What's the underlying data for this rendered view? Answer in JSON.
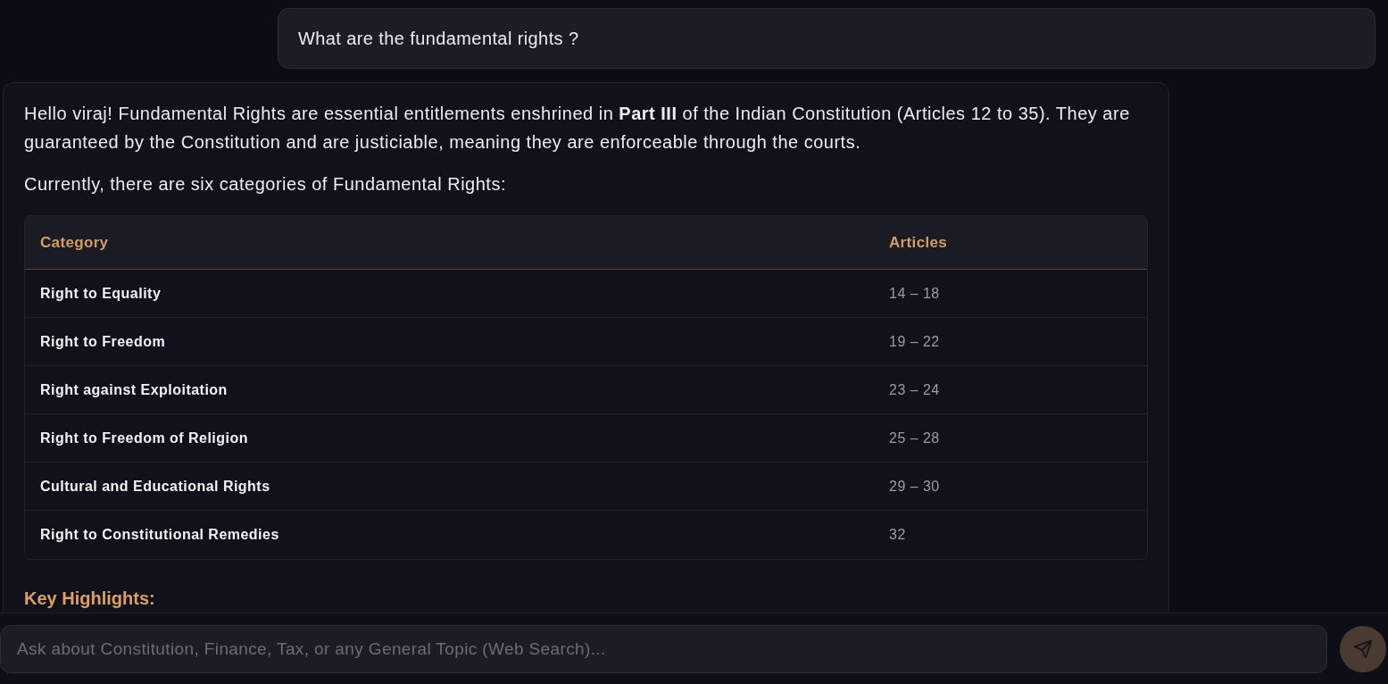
{
  "user_message": {
    "text": "What are the fundamental rights ?"
  },
  "assistant_message": {
    "paragraphs": [
      "Hello viraj! Fundamental Rights are essential entitlements enshrined in **Part III** of the Indian Constitution (Articles 12 to 35). They are guaranteed by the Constitution and are justiciable, meaning they are enforceable through the courts.",
      "Currently, there are six categories of Fundamental Rights:"
    ],
    "table": {
      "columns": [
        "Category",
        "Articles"
      ],
      "rows": [
        [
          "Right to Equality",
          "14 – 18"
        ],
        [
          "Right to Freedom",
          "19 – 22"
        ],
        [
          "Right against Exploitation",
          "23 – 24"
        ],
        [
          "Right to Freedom of Religion",
          "25 – 28"
        ],
        [
          "Cultural and Educational Rights",
          "29 – 30"
        ],
        [
          "Right to Constitutional Remedies",
          "32"
        ]
      ]
    },
    "heading": "Key Highlights:"
  },
  "composer": {
    "placeholder": "Ask about Constitution, Finance, Tax, or any General Topic (Web Search)..."
  }
}
